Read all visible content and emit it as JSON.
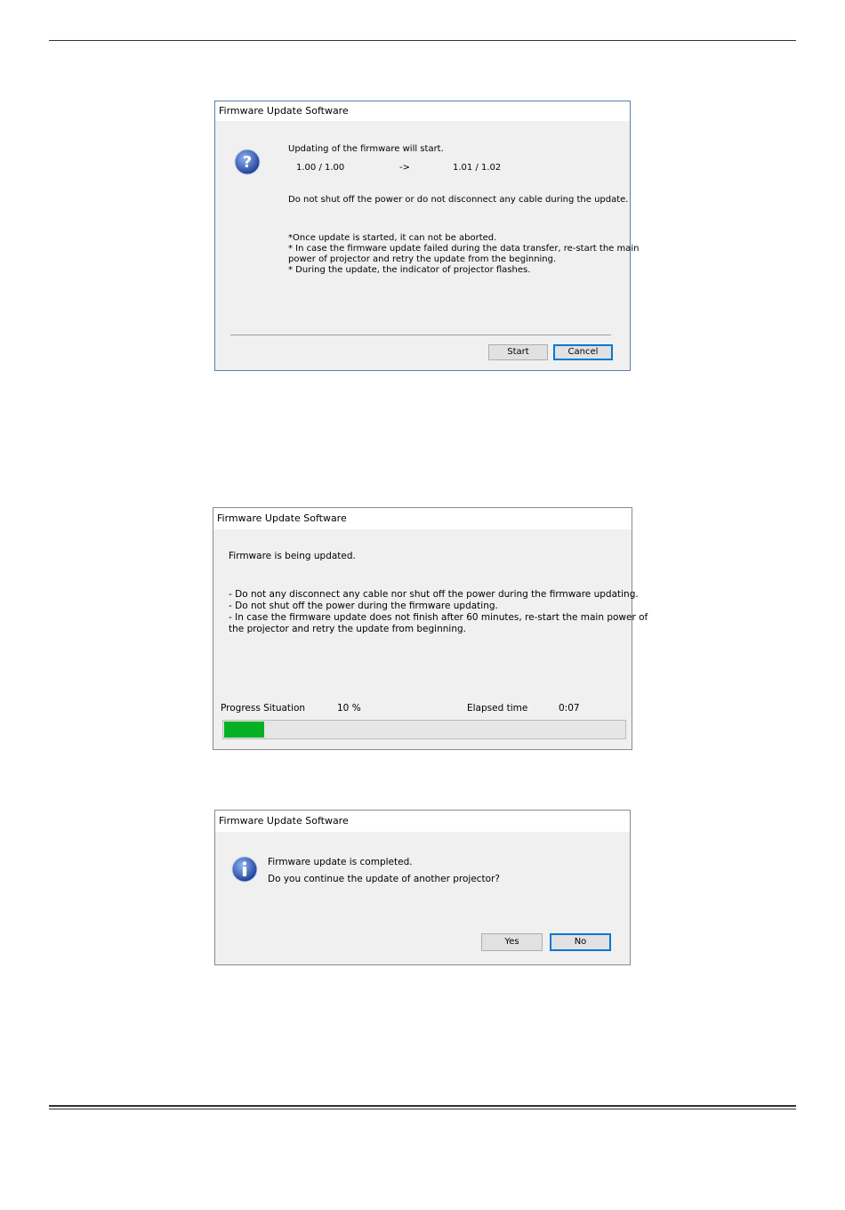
{
  "dialog1": {
    "title": "Firmware Update Software",
    "icon": "question-icon",
    "message": "Updating of the firmware will start.",
    "current_version": "1.00 / 1.00",
    "arrow": "->",
    "new_version": "1.01 / 1.02",
    "warning": "Do not shut off the power or do not disconnect any cable during the update.",
    "notes": [
      "*Once update is started, it can not be aborted.",
      "* In case the firmware update failed during the data transfer, re-start the main",
      "power of projector and retry the update from the beginning.",
      "* During the update, the indicator of projector flashes."
    ],
    "start_button": "Start",
    "cancel_button": "Cancel"
  },
  "dialog2": {
    "title": "Firmware Update Software",
    "status": "Firmware is being updated.",
    "notes": [
      "- Do not any disconnect any cable nor shut off the power during the firmware updating.",
      "- Do not shut off the power during the firmware updating.",
      "- In case the firmware update does not finish after 60 minutes, re-start the main power of",
      "the projector and retry the update from beginning."
    ],
    "progress_label": "Progress Situation",
    "progress_value": "10 %",
    "progress_fraction": 0.1,
    "elapsed_label": "Elapsed time",
    "elapsed_value": "0:07",
    "progress_color": "#06b025"
  },
  "dialog3": {
    "title": "Firmware Update Software",
    "icon": "info-icon",
    "message_line1": "Firmware update is completed.",
    "message_line2": "Do you continue the update of another projector?",
    "yes_button": "Yes",
    "no_button": "No"
  },
  "colors": {
    "dialog_bg": "#f0f0f0",
    "accent": "#0078d7"
  }
}
